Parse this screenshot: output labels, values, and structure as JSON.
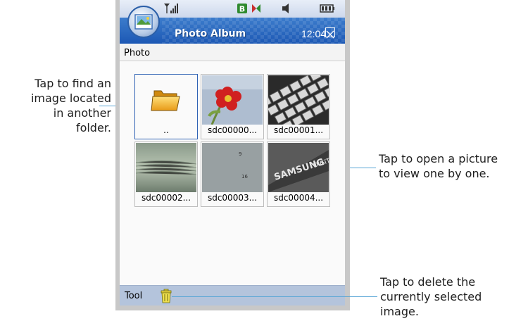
{
  "app": {
    "title": "Photo Album",
    "clock": "12:04"
  },
  "status_icons": [
    "signal-icon",
    "b-icon",
    "sms-icon",
    "speaker-icon",
    "battery-icon"
  ],
  "breadcrumb": "Photo",
  "thumbnails": [
    {
      "caption": "..",
      "kind": "folder"
    },
    {
      "caption": "sdc00000...",
      "kind": "image"
    },
    {
      "caption": "sdc00001...",
      "kind": "image"
    },
    {
      "caption": "sdc00002...",
      "kind": "image"
    },
    {
      "caption": "sdc00003...",
      "kind": "image"
    },
    {
      "caption": "sdc00004...",
      "kind": "image"
    }
  ],
  "toolbar": {
    "label": "Tool"
  },
  "callouts": {
    "folder": [
      "Tap to find an",
      "image located",
      "in another",
      "folder."
    ],
    "picture": [
      "Tap to open a picture",
      "to view one by one."
    ],
    "delete": [
      "Tap to delete the",
      "currently selected",
      "image."
    ]
  },
  "colors": {
    "title_bar": "#1c58b4",
    "toolbar": "#b4c4dc",
    "leader_line": "#5aa6d6"
  }
}
